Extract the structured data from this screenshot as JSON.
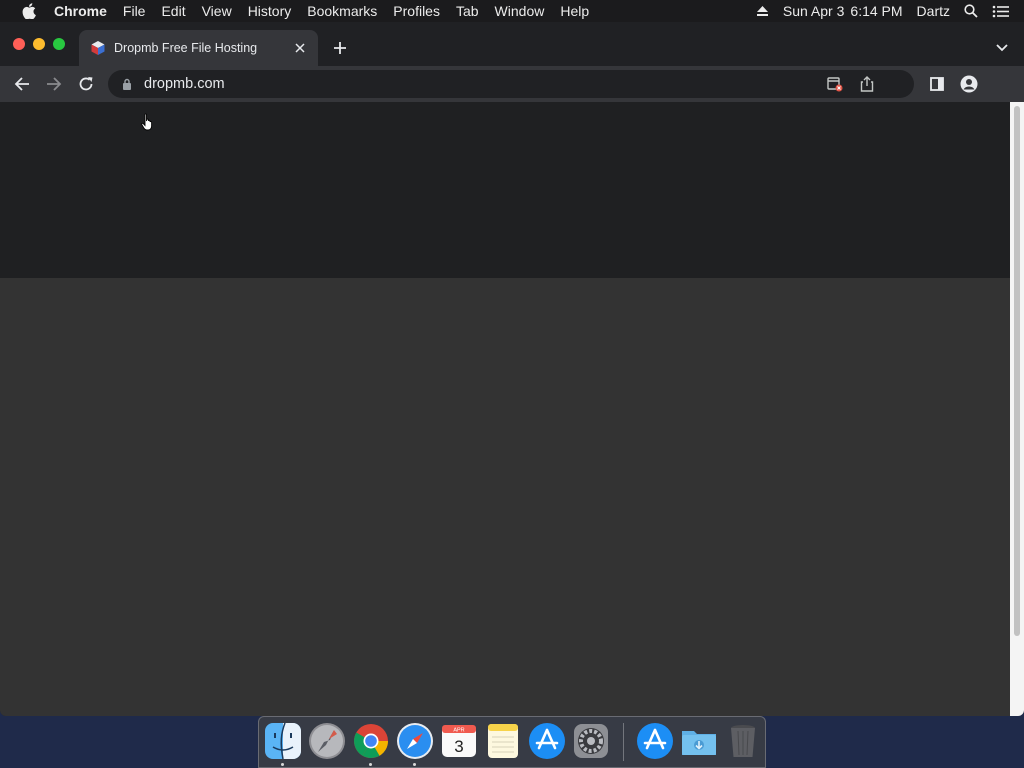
{
  "menubar": {
    "app_name": "Chrome",
    "items": [
      "File",
      "Edit",
      "View",
      "History",
      "Bookmarks",
      "Profiles",
      "Tab",
      "Window",
      "Help"
    ],
    "date": "Sun Apr 3",
    "time": "6:14 PM",
    "user": "Dartz",
    "icons": [
      "apple-icon",
      "eject-icon",
      "spotlight-search-icon",
      "control-center-icon"
    ]
  },
  "browser": {
    "tab": {
      "title": "Dropmb Free File Hosting",
      "favicon": "dropmb-cube-icon"
    },
    "omnibox": {
      "url": "dropmb.com"
    },
    "toolbar_icons": [
      "back-icon",
      "forward-icon",
      "reload-icon",
      "lock-icon",
      "popup-blocked-icon",
      "share-icon",
      "side-panel-icon",
      "profile-icon"
    ]
  },
  "dock": {
    "apps": [
      "Finder",
      "Launchpad",
      "Google Chrome",
      "Safari",
      "Calendar",
      "Notes",
      "App Store",
      "System Preferences",
      "App Store Downloads",
      "Downloads",
      "Trash"
    ],
    "calendar_month": "APR",
    "calendar_day": "3"
  },
  "colors": {
    "menubar_bg": "#1b1b1d",
    "window_bg": "#202124",
    "toolbar_bg": "#35363a",
    "content_header_bg": "#1f2022",
    "content_bg": "#333333",
    "desktop_bg": "#1f2a4a"
  }
}
